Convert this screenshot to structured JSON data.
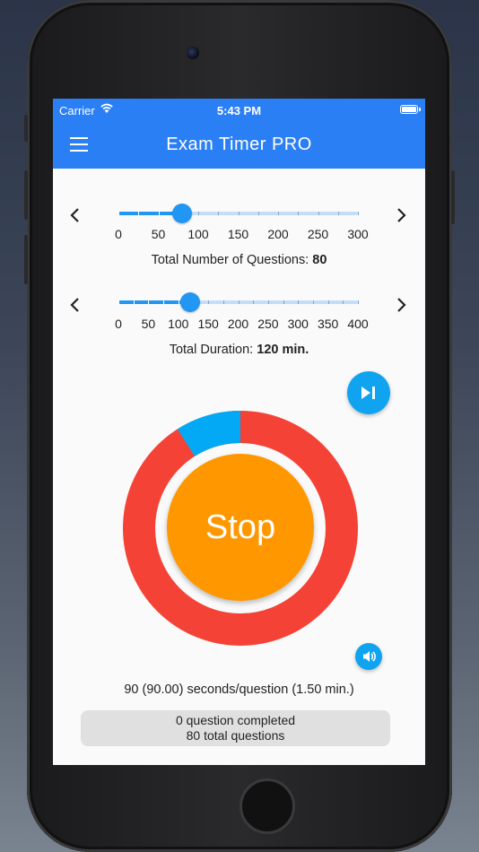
{
  "status_bar": {
    "carrier": "Carrier",
    "time": "5:43 PM"
  },
  "app_bar": {
    "title": "Exam Timer PRO"
  },
  "questions_slider": {
    "tick_labels": [
      "0",
      "50",
      "100",
      "150",
      "200",
      "250",
      "300"
    ],
    "value": 80,
    "max": 300,
    "caption_label": "Total Number of Questions:",
    "caption_value": "80"
  },
  "duration_slider": {
    "tick_labels": [
      "0",
      "50",
      "100",
      "150",
      "200",
      "250",
      "300",
      "350",
      "400"
    ],
    "value": 120,
    "max": 400,
    "caption_label": "Total Duration:",
    "caption_value": "120 min."
  },
  "timer": {
    "button_label": "Stop",
    "elapsed_fraction": 0.09,
    "elapsed_color": "#03a9f4",
    "remaining_color": "#f44336",
    "button_color": "#ff9800"
  },
  "rate_text": "90 (90.00) seconds/question (1.50 min.)",
  "progress": {
    "completed": "0 question completed",
    "total": "80 total questions"
  },
  "icons": {
    "menu": "menu-icon",
    "prev": "chevron-left-icon",
    "next": "chevron-right-icon",
    "skip": "skip-next-icon",
    "sound": "volume-icon"
  },
  "colors": {
    "app_bar": "#2b7ff5",
    "accent": "#2196f3",
    "fab": "#10a4f0"
  }
}
